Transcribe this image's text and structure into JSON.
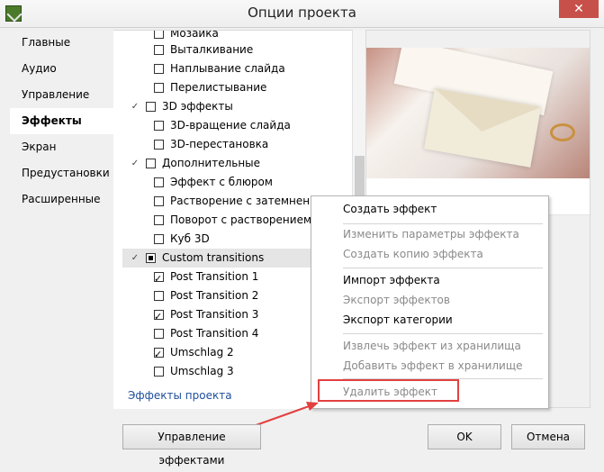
{
  "window": {
    "title": "Опции проекта",
    "close_glyph": "✕"
  },
  "nav": {
    "items": [
      {
        "label": "Главные",
        "active": false
      },
      {
        "label": "Аудио",
        "active": false
      },
      {
        "label": "Управление",
        "active": false
      },
      {
        "label": "Эффекты",
        "active": true
      },
      {
        "label": "Экран",
        "active": false
      },
      {
        "label": "Предустановки",
        "active": false
      },
      {
        "label": "Расширенные",
        "active": false
      }
    ]
  },
  "tree": {
    "rows": [
      {
        "label": "Мозаика",
        "checked": false
      },
      {
        "label": "Выталкивание",
        "checked": false
      },
      {
        "label": "Наплывание слайда",
        "checked": false
      },
      {
        "label": "Перелистывание",
        "checked": false
      },
      {
        "label": "3D эффекты",
        "checked": false,
        "group": true
      },
      {
        "label": "3D-вращение слайда",
        "checked": false
      },
      {
        "label": "3D-перестановка",
        "checked": false
      },
      {
        "label": "Дополнительные",
        "checked": false,
        "group": true
      },
      {
        "label": "Эффект с блюром",
        "checked": false
      },
      {
        "label": "Растворение с затемнением",
        "checked": false
      },
      {
        "label": "Поворот с растворением",
        "checked": false
      },
      {
        "label": "Куб 3D",
        "checked": false
      },
      {
        "label": "Custom transitions",
        "checked": "partial",
        "group": true,
        "selected": true
      },
      {
        "label": "Post Transition 1",
        "checked": true
      },
      {
        "label": "Post Transition 2",
        "checked": false
      },
      {
        "label": "Post Transition 3",
        "checked": true
      },
      {
        "label": "Post Transition 4",
        "checked": false
      },
      {
        "label": "Umschlag 2",
        "checked": true
      },
      {
        "label": "Umschlag 3",
        "checked": false
      }
    ],
    "footer_label": "Эффекты проекта"
  },
  "context_menu": {
    "items": [
      {
        "label": "Создать эффект",
        "enabled": true
      },
      {
        "label": "Изменить параметры эффекта",
        "enabled": false
      },
      {
        "label": "Создать копию эффекта",
        "enabled": false
      },
      {
        "label": "Импорт эффекта",
        "enabled": true
      },
      {
        "label": "Экспорт эффектов",
        "enabled": false
      },
      {
        "label": "Экспорт категории",
        "enabled": true
      },
      {
        "label": "Извлечь эффект из хранилища",
        "enabled": false
      },
      {
        "label": "Добавить эффект в хранилище",
        "enabled": false
      },
      {
        "label": "Удалить эффект",
        "enabled": false
      }
    ]
  },
  "buttons": {
    "manage_effects": "Управление эффектами",
    "ok": "OK",
    "cancel": "Отмена"
  },
  "colors": {
    "annotation_red": "#e24040",
    "link_blue": "#1f4e9b",
    "close_red": "#c7504b"
  }
}
